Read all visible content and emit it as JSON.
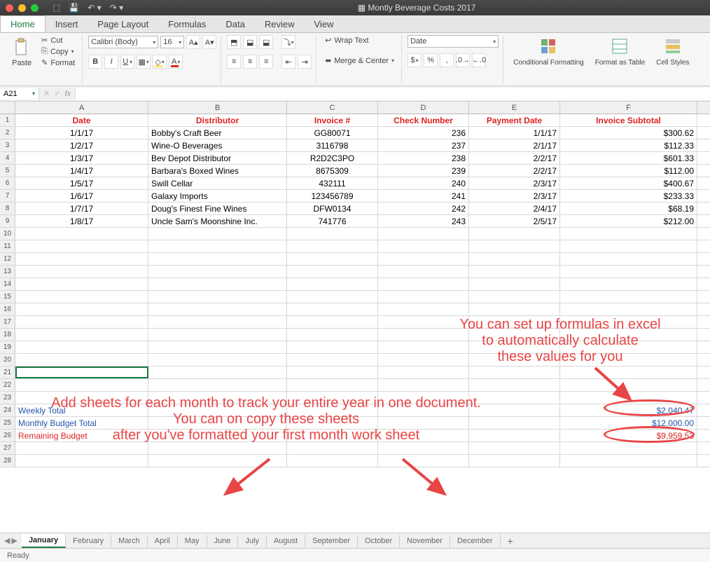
{
  "window": {
    "title": "Montly Beverage Costs 2017"
  },
  "tabs": [
    "Home",
    "Insert",
    "Page Layout",
    "Formulas",
    "Data",
    "Review",
    "View"
  ],
  "activeTab": "Home",
  "clipboard": {
    "paste": "Paste",
    "cut": "Cut",
    "copy": "Copy",
    "format": "Format"
  },
  "font": {
    "family": "Calibri (Body)",
    "size": "16"
  },
  "alignment": {
    "wrap": "Wrap Text",
    "merge": "Merge & Center"
  },
  "number": {
    "format": "Date"
  },
  "styles": {
    "cond": "Conditional Formatting",
    "table": "Format as Table",
    "cell": "Cell Styles"
  },
  "namebox": "A21",
  "columns": [
    "A",
    "B",
    "C",
    "D",
    "E",
    "F"
  ],
  "headers": {
    "A": "Date",
    "B": "Distributor",
    "C": "Invoice #",
    "D": "Check Number",
    "E": "Payment Date",
    "F": "Invoice Subtotal"
  },
  "rows": [
    {
      "A": "1/1/17",
      "B": "Bobby's Craft Beer",
      "C": "GG80071",
      "D": "236",
      "E": "1/1/17",
      "F": "$300.62"
    },
    {
      "A": "1/2/17",
      "B": "Wine-O Beverages",
      "C": "3116798",
      "D": "237",
      "E": "2/1/17",
      "F": "$112.33"
    },
    {
      "A": "1/3/17",
      "B": "Bev Depot Distributor",
      "C": "R2D2C3PO",
      "D": "238",
      "E": "2/2/17",
      "F": "$601.33"
    },
    {
      "A": "1/4/17",
      "B": "Barbara's Boxed Wines",
      "C": "8675309",
      "D": "239",
      "E": "2/2/17",
      "F": "$112.00"
    },
    {
      "A": "1/5/17",
      "B": "Swill Cellar",
      "C": "432111",
      "D": "240",
      "E": "2/3/17",
      "F": "$400.67"
    },
    {
      "A": "1/6/17",
      "B": "Galaxy Imports",
      "C": "123456789",
      "D": "241",
      "E": "2/3/17",
      "F": "$233.33"
    },
    {
      "A": "1/7/17",
      "B": "Doug's Finest Fine Wines",
      "C": "DFW0134",
      "D": "242",
      "E": "2/4/17",
      "F": "$68.19"
    },
    {
      "A": "1/8/17",
      "B": "Uncle Sam's Moonshine Inc.",
      "C": "741776",
      "D": "243",
      "E": "2/5/17",
      "F": "$212.00"
    }
  ],
  "totals": {
    "weekly": {
      "label": "Weekly Total",
      "value": "$2,040.47"
    },
    "budget": {
      "label": "Monthly Budget Total",
      "value": "$12,000.00"
    },
    "remaining": {
      "label": "Remaining Budget",
      "value": "$9,959.53"
    }
  },
  "sheets": [
    "January",
    "February",
    "March",
    "April",
    "May",
    "June",
    "July",
    "August",
    "September",
    "October",
    "November",
    "December"
  ],
  "activeSheet": "January",
  "status": "Ready",
  "annotations": {
    "a1": "You can set up formulas in excel\nto automatically calculate\nthese values for you",
    "a2": "Add sheets for each month to track your entire year in one document.\nYou can on copy these sheets\nafter you've formatted your first month work sheet"
  }
}
